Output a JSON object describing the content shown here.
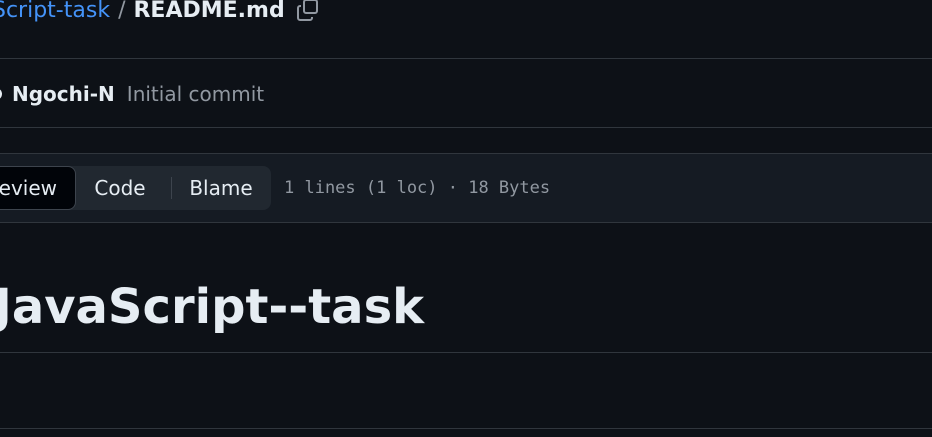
{
  "breadcrumb": {
    "repo": "Script-task",
    "separator": "/",
    "file": "README.md",
    "copy_icon": "copy-icon"
  },
  "commit": {
    "avatar_icon": "avatar",
    "author": "Ngochi-N",
    "message": "Initial commit"
  },
  "toolbar": {
    "tabs": [
      {
        "label": "eview",
        "selected": true
      },
      {
        "label": "Code",
        "selected": false
      },
      {
        "label": "Blame",
        "selected": false
      }
    ],
    "file_info": "1 lines (1 loc) · 18 Bytes"
  },
  "content": {
    "heading": "JavaScript--task"
  },
  "colors": {
    "background": "#0d1117",
    "link": "#4493f8",
    "text": "#e6edf3",
    "muted": "#9198a1",
    "border": "#30363d"
  }
}
